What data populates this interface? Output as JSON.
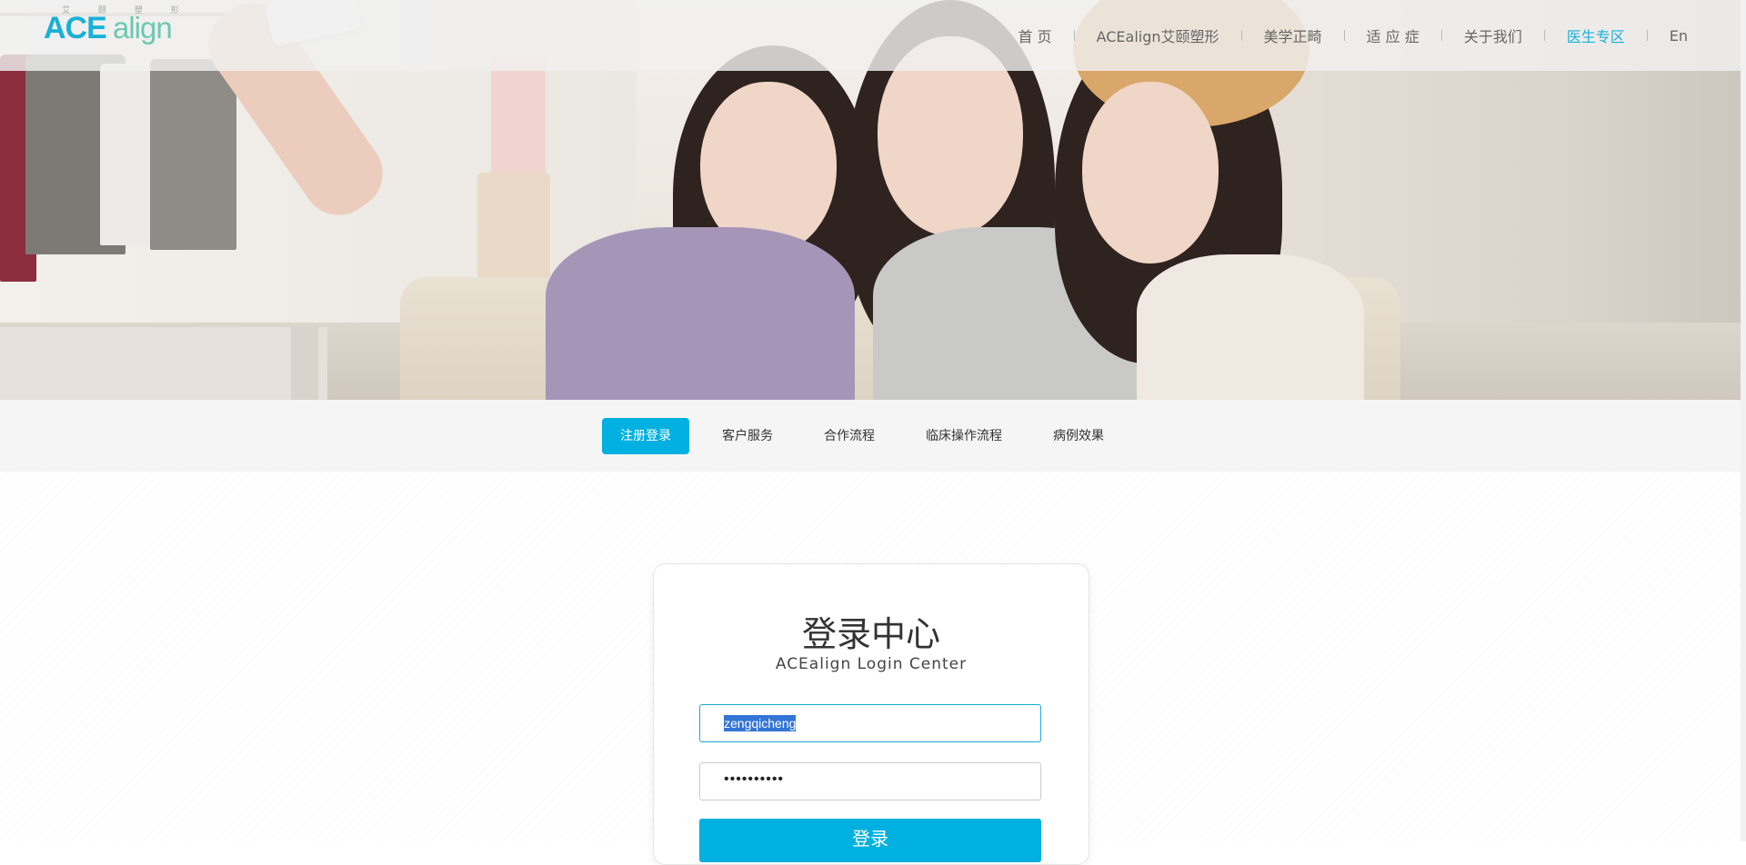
{
  "header": {
    "logo": {
      "tagline": "艾 颐 塑 形",
      "brand_ace": "ACE",
      "brand_align": "align"
    },
    "nav": [
      {
        "label": "首 页",
        "active": false
      },
      {
        "label": "ACEalign艾颐塑形",
        "active": false
      },
      {
        "label": "美学正畸",
        "active": false
      },
      {
        "label": "适 应 症",
        "active": false
      },
      {
        "label": "关于我们",
        "active": false
      },
      {
        "label": "医生专区",
        "active": true
      },
      {
        "label": "En",
        "active": false
      }
    ]
  },
  "subnav": {
    "tabs": [
      {
        "label": "注册登录",
        "active": true
      },
      {
        "label": "客户服务",
        "active": false
      },
      {
        "label": "合作流程",
        "active": false
      },
      {
        "label": "临床操作流程",
        "active": false
      },
      {
        "label": "病例效果",
        "active": false
      }
    ]
  },
  "login": {
    "title": "登录中心",
    "subtitle": "ACEalign Login Center",
    "username_value": "zengqicheng",
    "password_mask": "••••••••••",
    "submit_label": "登录"
  },
  "colors": {
    "accent": "#00b0e0",
    "nav_active": "#1ab0d6",
    "selection": "#3375d6"
  }
}
